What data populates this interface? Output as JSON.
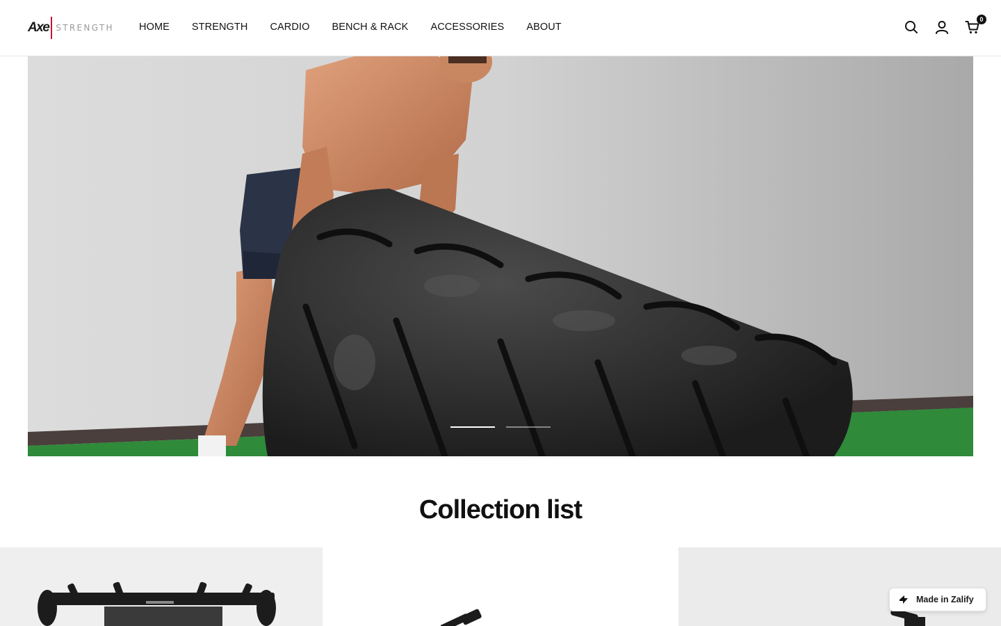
{
  "header": {
    "logo": {
      "mark": "Axe",
      "word": "STRENGTH"
    },
    "nav": [
      "HOME",
      "STRENGTH",
      "CARDIO",
      "BENCH & RACK",
      "ACCESSORIES",
      "ABOUT"
    ],
    "icons": [
      "search-icon",
      "account-icon",
      "cart-icon"
    ],
    "cart_count": "0"
  },
  "hero": {
    "slides_total": 2,
    "active_slide": 1
  },
  "collections": {
    "title": "Collection list",
    "cards": [
      "collection-card-1",
      "collection-card-2",
      "collection-card-3"
    ]
  },
  "badge": {
    "label": "Made in Zalify"
  },
  "colors": {
    "accent": "#c8102e",
    "text": "#111111",
    "turf": "#2f8a3a"
  }
}
